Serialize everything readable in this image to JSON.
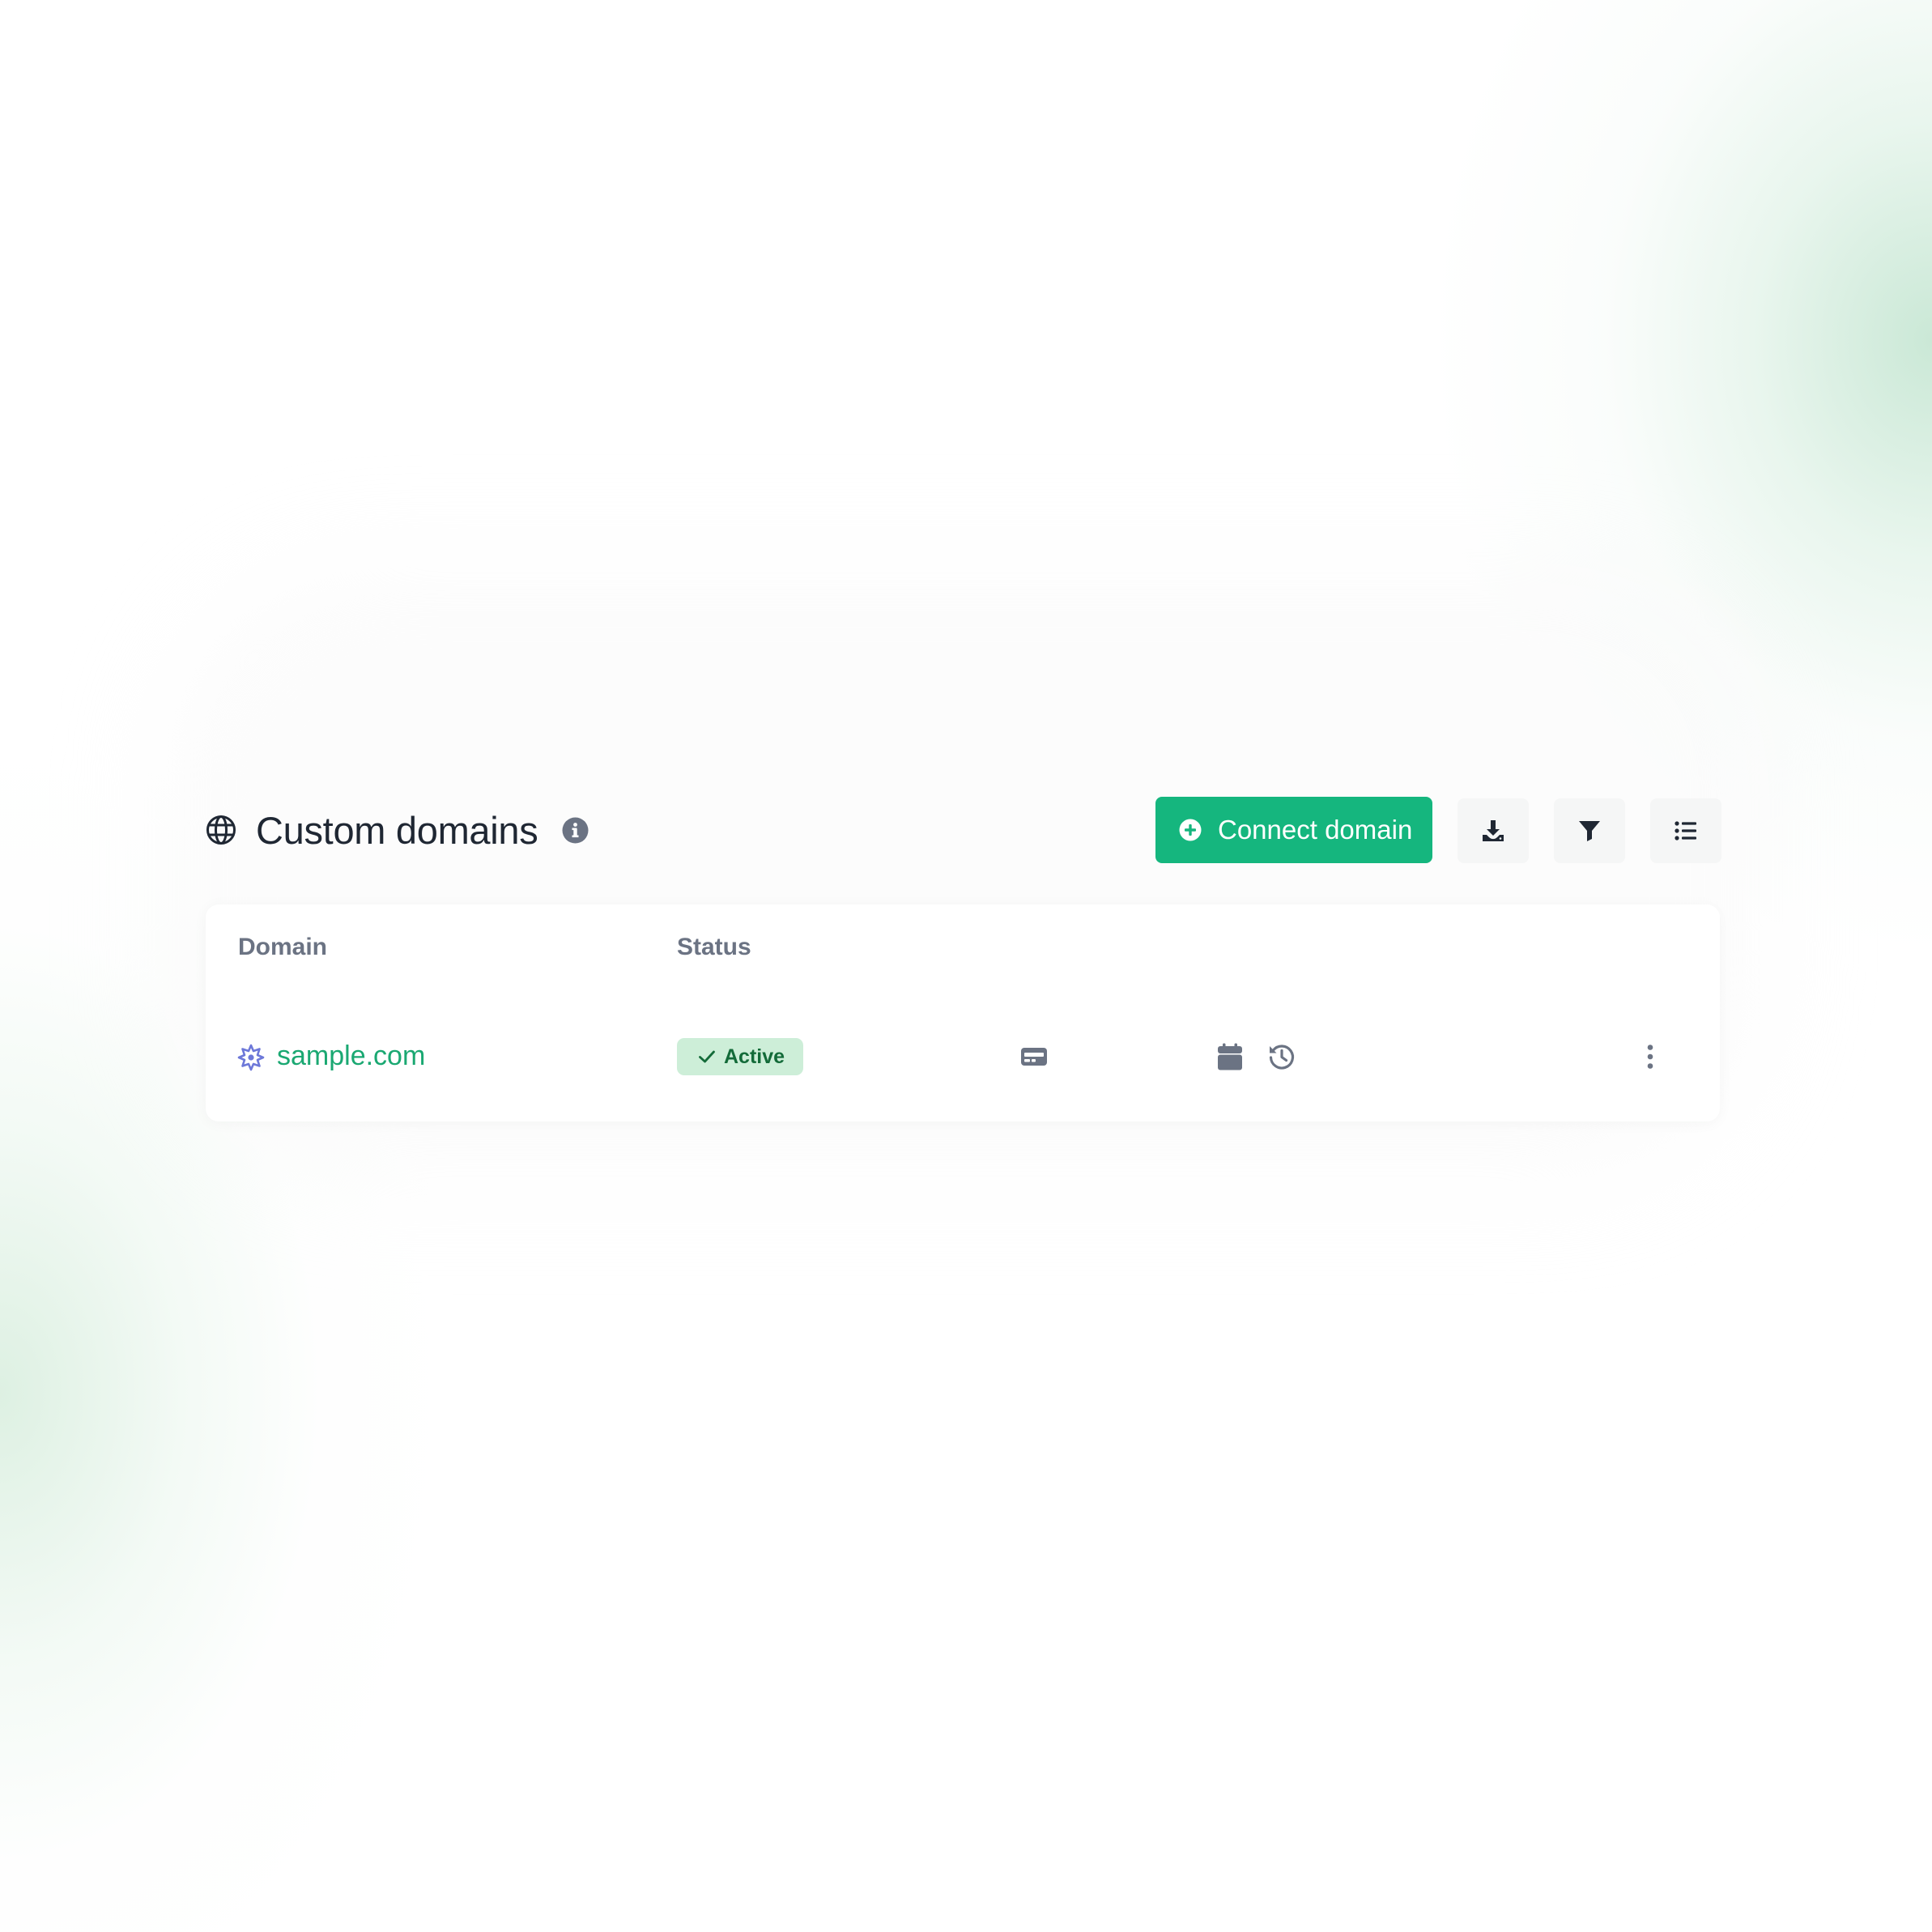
{
  "header": {
    "title": "Custom domains",
    "connect_label": "Connect domain",
    "icons": {
      "title": "globe-icon",
      "info": "info-icon",
      "connect": "plus-circle-icon",
      "download": "download-icon",
      "filter": "filter-icon",
      "list": "list-icon"
    }
  },
  "table": {
    "columns": [
      "Domain",
      "Status"
    ],
    "rows": [
      {
        "domain": "sample.com",
        "domain_icon": "badge-icon",
        "status": "Active",
        "status_icon": "check-icon",
        "action_icons": [
          "card-icon",
          "calendar-icon",
          "history-icon",
          "more-vertical-icon"
        ]
      }
    ]
  },
  "colors": {
    "accent": "#15b67e",
    "link": "#1aa872",
    "badge_bg": "#cdeed8",
    "badge_text": "#136b39",
    "header_text": "#6b7383",
    "icon_gray": "#6b7383",
    "domain_icon": "#6d78d9"
  }
}
